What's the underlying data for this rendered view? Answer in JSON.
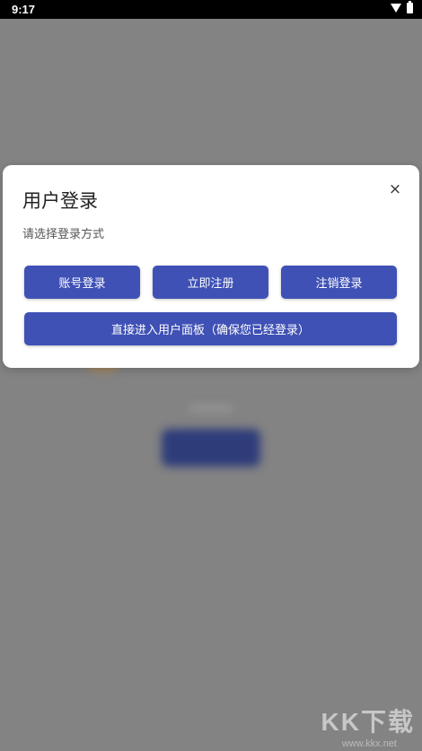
{
  "status_bar": {
    "time": "9:17"
  },
  "dialog": {
    "title": "用户登录",
    "close_symbol": "×",
    "subtitle": "请选择登录方式",
    "buttons": {
      "account_login": "账号登录",
      "register_now": "立即注册",
      "logout": "注销登录",
      "direct_enter": "直接进入用户面板（确保您已经登录）"
    }
  },
  "watermark": {
    "text": "KK下载",
    "sub": "www.kkx.net"
  },
  "colors": {
    "primary": "#3f51b5",
    "scrim": "#8a8a8a",
    "status_bar": "#000000"
  },
  "icons": {
    "wifi": "wifi-icon",
    "battery": "battery-icon",
    "close": "close-icon"
  }
}
